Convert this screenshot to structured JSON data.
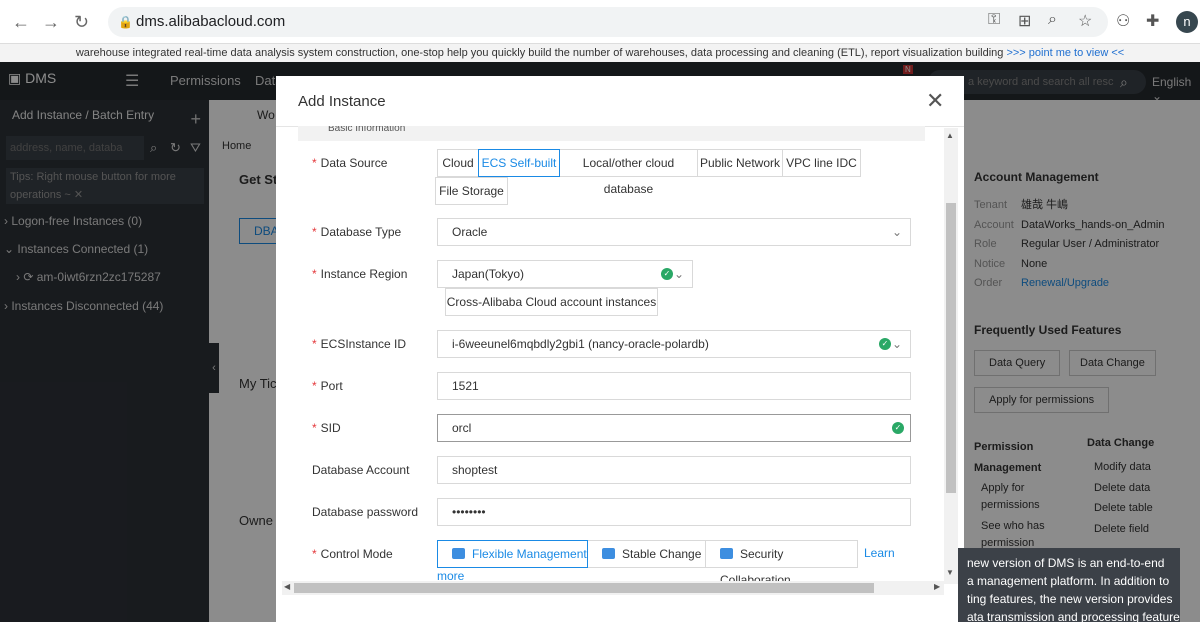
{
  "browser": {
    "url": "dms.alibabacloud.com",
    "avatar_letter": "n"
  },
  "banner": {
    "text": "warehouse integrated real-time data analysis system construction, one-stop help you quickly build the number of warehouses, data processing and cleaning (ETL), report visualization building",
    "link": ">>> point me to view <<"
  },
  "topnav": {
    "logo": "DMS",
    "permissions": "Permissions",
    "partial_item": "Data",
    "search_placeholder": "a keyword and search all resc",
    "language": "English",
    "badge": "N"
  },
  "sidebar": {
    "header": "Add Instance / Batch Entry",
    "search_placeholder": "address, name, databa",
    "tips": "Tips: Right mouse button for more operations ~",
    "items": [
      {
        "label": "Logon-free Instances  (0)"
      },
      {
        "label": "Instances Connected  (1)"
      },
      {
        "label": "am-0iwt6rzn2zc175287"
      },
      {
        "label": "Instances Disconnected  (44)"
      }
    ]
  },
  "background": {
    "tab_partial": "Wo",
    "home": "Home",
    "start_partial": "Get St",
    "dba_partial": "DBA",
    "tickets_partial": "My Tic",
    "owner_partial": "Owne",
    "account_title": "Account Management",
    "account": [
      {
        "k": "Tenant",
        "v": "雄哉 牛嶋"
      },
      {
        "k": "Account",
        "v": "DataWorks_hands-on_Admin"
      },
      {
        "k": "Role",
        "v": "Regular User / Administrator"
      },
      {
        "k": "Notice",
        "v": "None"
      },
      {
        "k": "Order",
        "v": "Renewal/Upgrade"
      }
    ],
    "features_title": "Frequently Used Features",
    "features": [
      "Data Query",
      "Data Change",
      "Apply for permissions"
    ],
    "perm_title": "Permission Management",
    "perm_items": [
      "Apply for permissions",
      "See who has permission"
    ],
    "change_title": "Data Change",
    "change_items": [
      "Modify data",
      "Delete data",
      "Delete table",
      "Delete field"
    ]
  },
  "dialog": {
    "title": "Add Instance",
    "section_partial": "Basic Information",
    "labels": {
      "data_source": "Data Source",
      "database_type": "Database Type",
      "instance_region": "Instance Region",
      "ecs_instance_id": "ECSInstance ID",
      "port": "Port",
      "sid": "SID",
      "database_account": "Database Account",
      "database_password": "Database password",
      "control_mode": "Control Mode"
    },
    "data_sources": [
      "Cloud",
      "ECS Self-built",
      "Local/other cloud database",
      "Public Network",
      "VPC line IDC",
      "File Storage"
    ],
    "selected_source": "ECS Self-built",
    "database_type": "Oracle",
    "instance_region": "Japan(Tokyo)",
    "cross_account": "Cross-Alibaba Cloud account instances",
    "ecs_instance_id": "i-6weeunel6mqbdly2gbi1  (nancy-oracle-polardb)",
    "port": "1521",
    "sid": "orcl",
    "database_account": "shoptest",
    "database_password": "••••••••",
    "control_modes": [
      "Flexible Management",
      "Stable Change",
      "Security Collaboration"
    ],
    "learn_more_1": "Learn",
    "learn_more_2": "more"
  },
  "tooltip": {
    "lines": [
      "new version of DMS is an end-to-end",
      "a management platform. In addition to",
      "ting features, the new version provides",
      "ata transmission and processing feature"
    ]
  }
}
